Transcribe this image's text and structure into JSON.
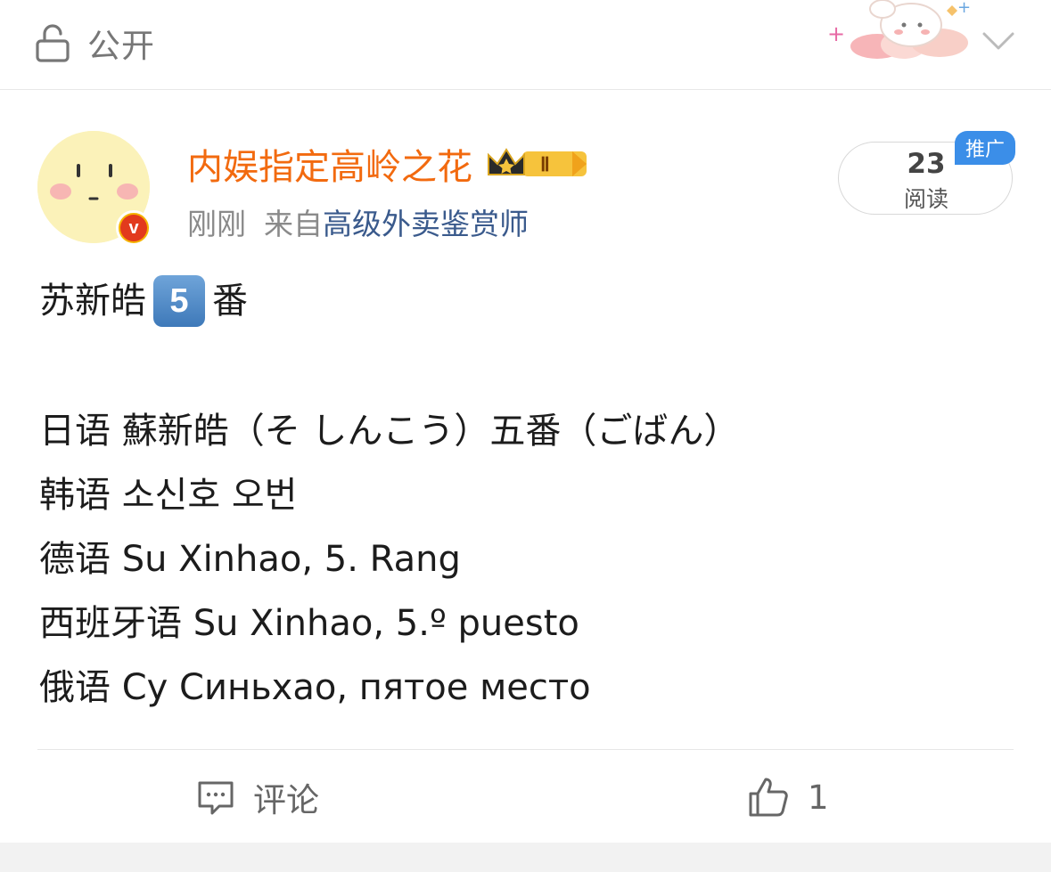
{
  "topbar": {
    "privacy_label": "公开",
    "privacy_icon": "lock-open-icon",
    "chevron_icon": "chevron-down-icon"
  },
  "post": {
    "author": "内娱指定高岭之花",
    "badge_label": "Ⅱ",
    "time": "刚刚",
    "from_prefix": "来自",
    "source": "高级外卖鉴赏师",
    "read_count": "23",
    "read_label": "阅读",
    "promo_tag": "推广",
    "verified_icon": "v",
    "content": {
      "line1_pre": "苏新皓",
      "line1_num": "5",
      "line1_post": "番",
      "lines": [
        "日语 蘇新皓（そ しんこう）五番（ごばん）",
        "韩语 소신호 오번",
        "德语 Su Xinhao, 5. Rang",
        "西班牙语 Su Xinhao, 5.º puesto",
        "俄语 Су Синьхао, пятое место"
      ]
    }
  },
  "actions": {
    "comment_label": "评论",
    "like_count": "1"
  },
  "colors": {
    "author": "#f26a0f",
    "source": "#3a5a8c",
    "promo": "#3b8ee8"
  }
}
